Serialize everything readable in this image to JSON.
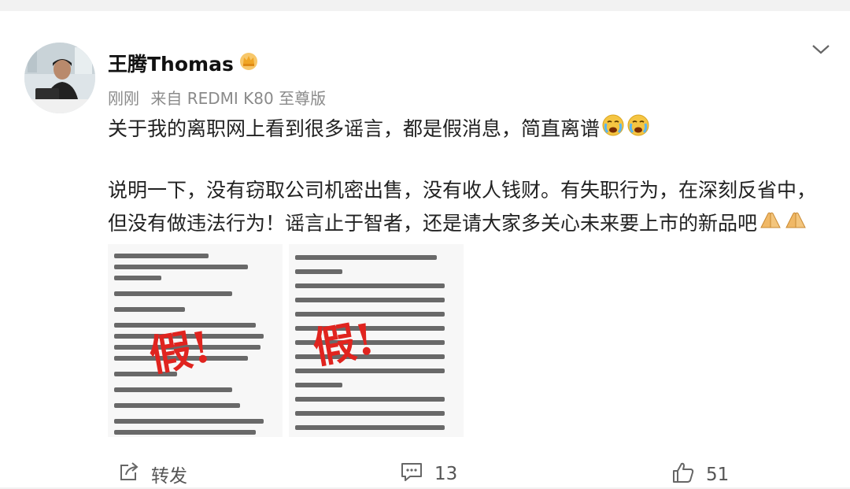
{
  "post": {
    "username": "王腾Thomas",
    "time": "刚刚",
    "source": "来自 REDMI K80 至尊版",
    "text_line1": "关于我的离职网上看到很多谣言，都是假消息，简直离谱",
    "text_line2": "说明一下，没有窃取公司机密出售，没有收人钱财。有失职行为，在深刻反省中，",
    "text_line3": "但没有做违法行为！谣言止于智者，还是请大家多关心未来要上市的新品吧",
    "stamp_text": "假!"
  },
  "actions": {
    "repost_label": "转发",
    "comment_count": "13",
    "like_count": "51"
  },
  "colors": {
    "stamp": "#e0241f",
    "emoji": "#f5c542",
    "crown": "#f0a524"
  },
  "icons": [
    "avatar",
    "crown-icon",
    "chevron-down-icon",
    "crying-emoji-icon",
    "pray-emoji-icon",
    "repost-icon",
    "comment-icon",
    "like-icon"
  ]
}
